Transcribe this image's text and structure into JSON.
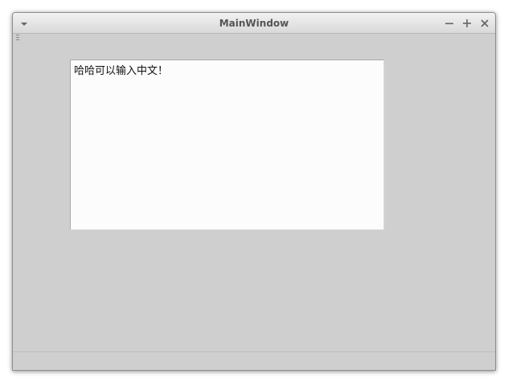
{
  "window": {
    "title": "MainWindow",
    "icons": {
      "menu": "chevron-down-icon",
      "minimize": "minimize-icon",
      "maximize": "maximize-icon",
      "close": "close-icon"
    }
  },
  "editor": {
    "text": "哈哈可以输入中文！"
  },
  "statusbar": {
    "text": ""
  },
  "colors": {
    "window_bg": "#cfcfcf",
    "editor_bg": "#fcfcfc",
    "title_text": "#555555"
  }
}
